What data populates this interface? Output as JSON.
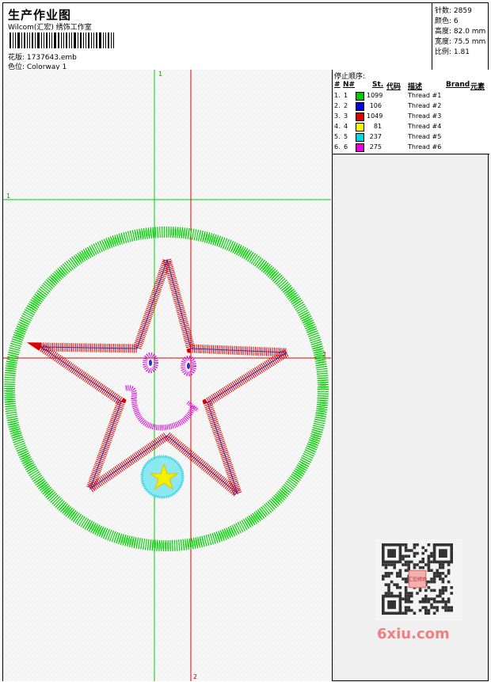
{
  "header": {
    "title": "生产作业图",
    "company": "Wilcom(汇宏) 绣饰工作室",
    "design_label": "花版: 1737643.emb",
    "colorway_label": "色位:  Colorway 1"
  },
  "stats": {
    "stitches": "针数:  2859",
    "colors": "颜色:  6",
    "height": "高度:  82.0 mm",
    "width": "宽度:  75.5 mm",
    "scale": "比例:  1.81"
  },
  "guides": {
    "v_green": "1",
    "h_green": "1",
    "v_red": "2",
    "h_red": "2"
  },
  "stop_sequence": {
    "title": "停止顺序:",
    "headers": {
      "num": "#",
      "n": "N#",
      "st": "St.",
      "code": "代码",
      "desc": "描述",
      "brand": "Brand",
      "element": "元素"
    },
    "rows": [
      {
        "num": "1.",
        "n": "1",
        "st": "1099",
        "color": "#00c800",
        "desc": "Thread #1"
      },
      {
        "num": "2.",
        "n": "2",
        "st": "106",
        "color": "#0000dc",
        "desc": "Thread #2"
      },
      {
        "num": "3.",
        "n": "3",
        "st": "1049",
        "color": "#dc0000",
        "desc": "Thread #3"
      },
      {
        "num": "4.",
        "n": "4",
        "st": "81",
        "color": "#ffff00",
        "desc": "Thread #4"
      },
      {
        "num": "5.",
        "n": "5",
        "st": "237",
        "color": "#00d8e0",
        "desc": "Thread #5"
      },
      {
        "num": "6.",
        "n": "6",
        "st": "275",
        "color": "#e000e0",
        "desc": "Thread #6"
      }
    ]
  },
  "watermark": {
    "site": "6xiu.com",
    "qr_center_text": "汇宏绣饰"
  }
}
